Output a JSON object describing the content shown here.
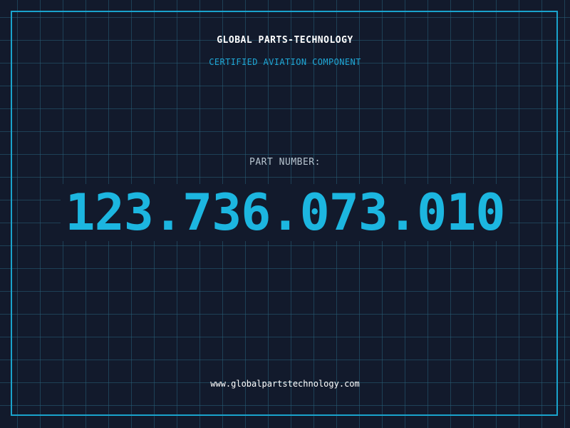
{
  "header": {
    "brand": "GLOBAL PARTS-TECHNOLOGY",
    "subtitle": "CERTIFIED AVIATION COMPONENT"
  },
  "part": {
    "label": "PART NUMBER:",
    "number": "123.736.073.010"
  },
  "footer": {
    "website": "www.globalpartstechnology.com"
  },
  "colors": {
    "background": "#121a2c",
    "grid": "#285f78",
    "frame": "#1aa3cc",
    "accent": "#1cb6e0",
    "text": "#ffffff",
    "muted": "#b7c4cf"
  }
}
